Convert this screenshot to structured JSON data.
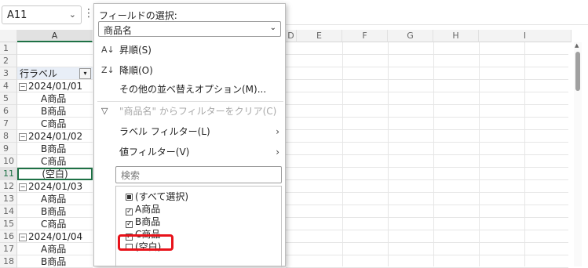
{
  "name_box": {
    "value": "A11"
  },
  "columns": [
    "A",
    "B",
    "C",
    "D",
    "E",
    "F",
    "G",
    "H",
    "I"
  ],
  "rows": [
    {
      "num": "1",
      "text": "",
      "kind": "plain"
    },
    {
      "num": "2",
      "text": "",
      "kind": "plain"
    },
    {
      "num": "3",
      "text": "行ラベル",
      "kind": "header"
    },
    {
      "num": "4",
      "text": "2024/01/01",
      "kind": "group"
    },
    {
      "num": "5",
      "text": "A商品",
      "kind": "item"
    },
    {
      "num": "6",
      "text": "B商品",
      "kind": "item"
    },
    {
      "num": "7",
      "text": "C商品",
      "kind": "item"
    },
    {
      "num": "8",
      "text": "2024/01/02",
      "kind": "group"
    },
    {
      "num": "9",
      "text": "B商品",
      "kind": "item"
    },
    {
      "num": "10",
      "text": "C商品",
      "kind": "item"
    },
    {
      "num": "11",
      "text": "(空白)",
      "kind": "active"
    },
    {
      "num": "12",
      "text": "2024/01/03",
      "kind": "group"
    },
    {
      "num": "13",
      "text": "A商品",
      "kind": "item"
    },
    {
      "num": "14",
      "text": "B商品",
      "kind": "item"
    },
    {
      "num": "15",
      "text": "C商品",
      "kind": "item"
    },
    {
      "num": "16",
      "text": "2024/01/04",
      "kind": "group"
    },
    {
      "num": "17",
      "text": "A商品",
      "kind": "item"
    },
    {
      "num": "18",
      "text": "B商品",
      "kind": "item"
    }
  ],
  "filter_panel": {
    "title": "フィールドの選択:",
    "field_value": "商品名",
    "sort_asc": "昇順(S)",
    "sort_desc": "降順(O)",
    "more_sort": "その他の並べ替えオプション(M)...",
    "clear_filter": "\"商品名\" からフィルターをクリア(C)",
    "label_filter": "ラベル フィルター(L)",
    "value_filter": "値フィルター(V)",
    "search_placeholder": "検索",
    "items": [
      {
        "label": "(すべて選択)",
        "state": "partial"
      },
      {
        "label": "A商品",
        "state": "checked"
      },
      {
        "label": "B商品",
        "state": "checked"
      },
      {
        "label": "C商品",
        "state": "checked"
      },
      {
        "label": "(空白)",
        "state": "unchecked"
      }
    ]
  },
  "colors": {
    "accent": "#1e7145",
    "highlight": "#e8121a"
  }
}
